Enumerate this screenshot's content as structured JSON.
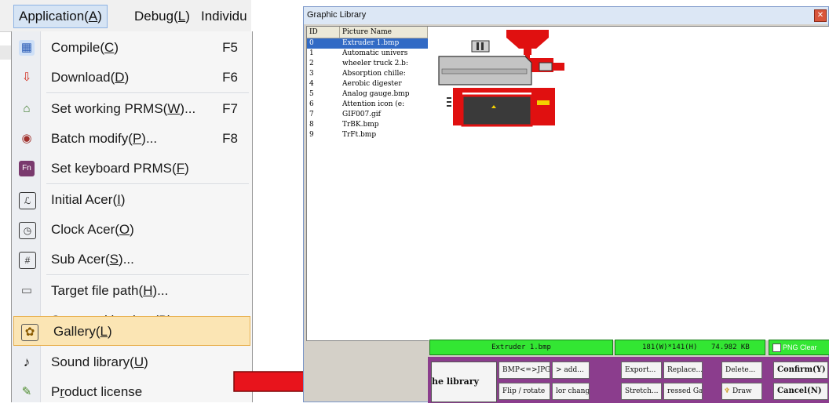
{
  "menubar": {
    "items": [
      {
        "label": "Application",
        "key": "(A)",
        "key_letter": "A"
      },
      {
        "label": "Debug",
        "key": "(L)",
        "key_letter": "L"
      },
      {
        "label": "Individu"
      }
    ]
  },
  "menu": {
    "items": [
      {
        "label": "Compile",
        "accel": "C",
        "shortcut": "F5",
        "icon": "compile-icon"
      },
      {
        "label": "Download",
        "accel": "D",
        "shortcut": "F6",
        "icon": "download-icon"
      },
      {
        "label": "Set working PRMS",
        "accel": "W",
        "suffix": "...",
        "shortcut": "F7",
        "icon": "house-icon"
      },
      {
        "label": "Batch modify",
        "accel": "P",
        "suffix": "...",
        "shortcut": "F8",
        "icon": "batch-modify-icon"
      },
      {
        "label": "Set keyboard PRMS",
        "accel": "F",
        "shortcut": "",
        "icon": "keyboard-fn-icon"
      },
      {
        "label": "Initial Acer",
        "accel": "I",
        "shortcut": "",
        "icon": "initial-acer-icon"
      },
      {
        "label": "Clock Acer",
        "accel": "O",
        "shortcut": "",
        "icon": "clock-acer-icon"
      },
      {
        "label": "Sub Acer",
        "accel": "S",
        "suffix": "...",
        "shortcut": "",
        "icon": "sub-acer-icon"
      },
      {
        "label": "Target file path",
        "accel": "H",
        "suffix": "...",
        "shortcut": "",
        "icon": "drive-icon"
      },
      {
        "label": "Save and backup",
        "accel": "B",
        "suffix": "...",
        "shortcut": "",
        "icon": "save-backup-icon"
      },
      {
        "label": "Gallery",
        "accel": "L",
        "shortcut": "",
        "icon": "gallery-icon",
        "selected": true
      },
      {
        "label": "Sound library",
        "accel": "U",
        "shortcut": "",
        "icon": "music-note-icon"
      },
      {
        "label": "Product license",
        "accel": "r",
        "shortcut": "",
        "icon": "license-icon"
      }
    ]
  },
  "window": {
    "title": "Graphic Library",
    "columns": {
      "id": "ID",
      "name": "Picture Name"
    },
    "rows": [
      {
        "id": "0",
        "name": "Extruder 1.bmp",
        "selected": true
      },
      {
        "id": "1",
        "name": "Automatic univers"
      },
      {
        "id": "2",
        "name": "wheeler truck 2.b:"
      },
      {
        "id": "3",
        "name": "Absorption chille:"
      },
      {
        "id": "4",
        "name": "Aerobic digester"
      },
      {
        "id": "5",
        "name": "Analog gauge.bmp"
      },
      {
        "id": "6",
        "name": "Attention icon (e:"
      },
      {
        "id": "7",
        "name": "GIF007.gif"
      },
      {
        "id": "8",
        "name": "TrBK.bmp"
      },
      {
        "id": "9",
        "name": "TrFt.bmp"
      }
    ],
    "status": {
      "filename": "Extruder 1.bmp",
      "dimensions": "181(W)*141(H)",
      "filesize": "74.982 KB",
      "png_clear": "PNG Clear"
    },
    "buttons": {
      "library": "he library",
      "bmp_jpg": "BMP<=>JPG ...",
      "add": "> add...",
      "export": "Export...",
      "replace": "Replace...",
      "delete": "Delete...",
      "confirm": "Confirm(Y)",
      "flip": "Flip / rotate",
      "color_change": "lor change",
      "stretch": "Stretch...",
      "compressed": "ressed Gal",
      "draw": "Draw",
      "cancel": "Cancel(N)"
    }
  },
  "colors": {
    "arrow": "#e8141c",
    "status_green": "#33e633",
    "toolbar_purple": "#8b3d8d",
    "selection_blue": "#316ac5",
    "menu_highlight": "#fbe5b4"
  }
}
